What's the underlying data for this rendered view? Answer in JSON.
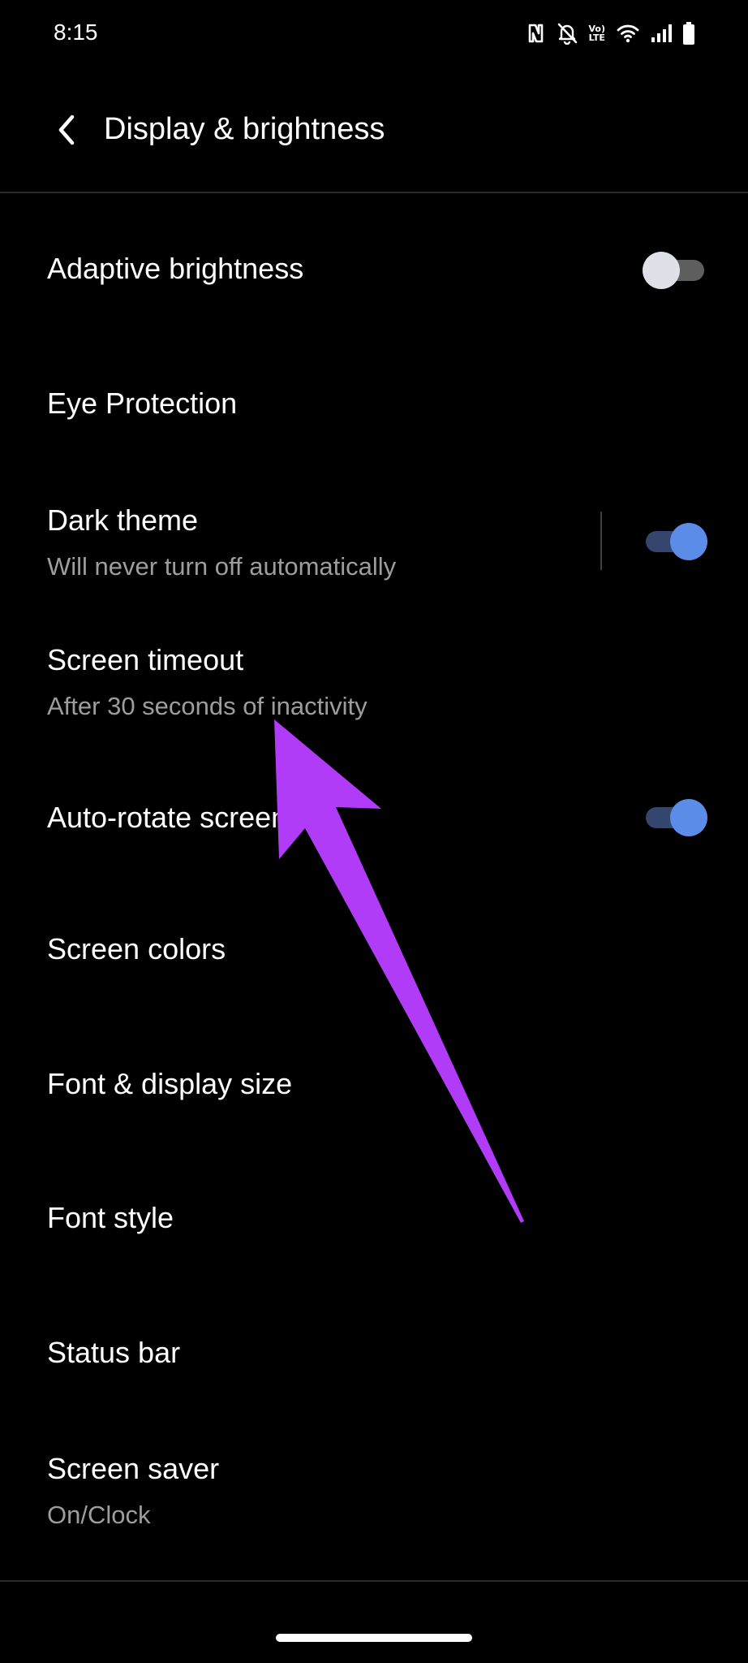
{
  "status_bar": {
    "time": "8:15",
    "lte_top": "Vo)",
    "lte_bottom": "LTE",
    "icons": [
      "nfc-icon",
      "notifications-off-icon",
      "volte-icon",
      "wifi-icon",
      "signal-icon",
      "battery-icon"
    ]
  },
  "header": {
    "back_icon": "chevron-left-icon",
    "title": "Display & brightness"
  },
  "settings": [
    {
      "title": "Adaptive brightness",
      "toggle": "off"
    },
    {
      "title": "Eye Protection"
    },
    {
      "title": "Dark theme",
      "subtitle": "Will never turn off automatically",
      "toggle": "on"
    },
    {
      "title": "Screen timeout",
      "subtitle": "After 30 seconds of inactivity"
    },
    {
      "title": "Auto-rotate screen",
      "toggle": "on"
    },
    {
      "title": "Screen colors"
    },
    {
      "title": "Font & display size"
    },
    {
      "title": "Font style"
    },
    {
      "title": "Status bar"
    },
    {
      "title": "Screen saver",
      "subtitle": "On/Clock"
    }
  ],
  "colors": {
    "background": "#000000",
    "toggle_on_knob": "#5b8de8",
    "toggle_on_track": "#34466e",
    "toggle_off_knob": "#dee2e8",
    "toggle_off_track": "#5e5e5e",
    "annotation_arrow": "#b13cf8"
  }
}
